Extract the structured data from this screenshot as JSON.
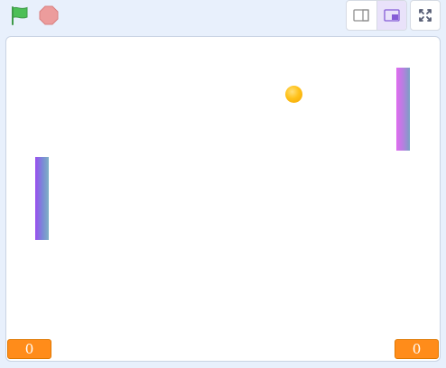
{
  "toolbar": {
    "green_flag_icon": "green-flag-icon",
    "stop_icon": "stop-sign-icon",
    "small_stage_icon": "small-stage-icon",
    "normal_stage_icon": "normal-stage-icon",
    "fullscreen_icon": "fullscreen-icon",
    "active_layout": "normal"
  },
  "stage": {
    "score_left": "0",
    "score_right": "0"
  },
  "colors": {
    "score_bg": "#ff8c1a",
    "flag": "#4cbf56",
    "stop": "#ec9c9c",
    "active_toggle": "#e9e2fa"
  }
}
